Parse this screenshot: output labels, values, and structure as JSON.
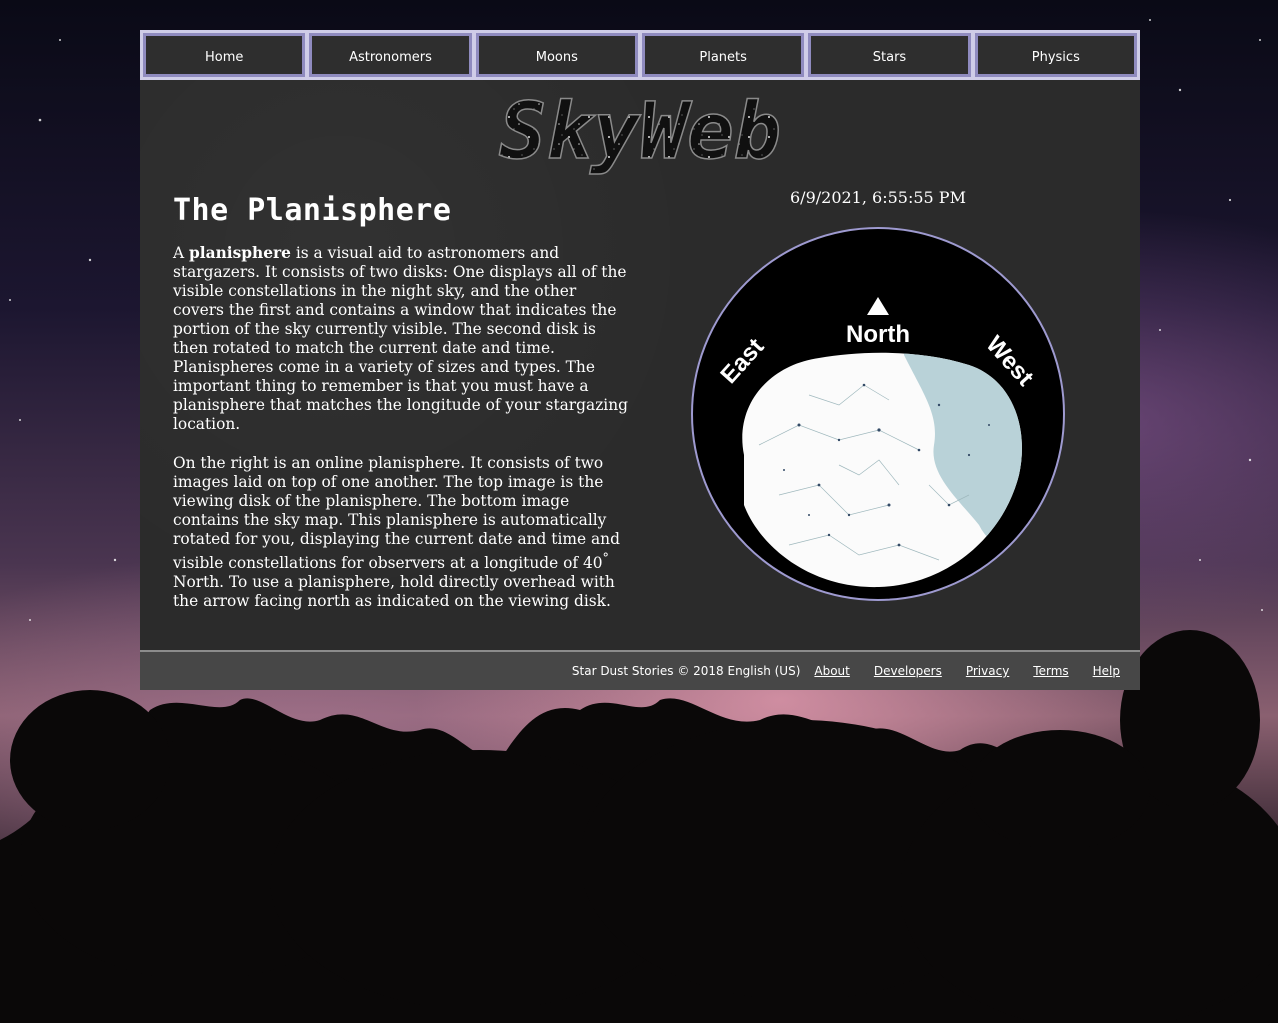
{
  "nav": {
    "items": [
      "Home",
      "Astronomers",
      "Moons",
      "Planets",
      "Stars",
      "Physics"
    ]
  },
  "logo": {
    "text": "SkyWeb"
  },
  "article": {
    "title": "The Planisphere",
    "p1_a": "A ",
    "p1_bold": "planisphere",
    "p1_b": " is a visual aid to astronomers and stargazers. It consists of two disks: One displays all of the visible constellations in the night sky, and the other covers the first and contains a window that indicates the portion of the sky currently visible. The second disk is then rotated to match the current date and time. Planispheres come in a variety of sizes and types. The important thing to remember is that you must have a planisphere that matches the longitude of your stargazing location.",
    "p2_a": "On the right is an online planisphere. It consists of two images laid on top of one another. The top image is the viewing disk of the planisphere. The bottom image contains the sky map. This planisphere is automatically rotated for you, displaying the current date and time and visible constellations for observers at a longitude of 40",
    "p2_deg": "°",
    "p2_b": " North. To use a planisphere, hold directly overhead with the arrow facing north as indicated on the viewing disk."
  },
  "planisphere": {
    "datetime": "6/9/2021, 6:55:55 PM",
    "north_label": "North",
    "east_label": "East",
    "west_label": "West"
  },
  "footer": {
    "copyright": "Star Dust Stories © 2018 English (US)",
    "links": [
      "About",
      "Developers",
      "Privacy",
      "Terms",
      "Help"
    ]
  },
  "colors": {
    "nav_border": "#8f8bbf",
    "nav_frame": "#cfcde8",
    "panel_bg": "#2b2b2b",
    "footer_bg": "#474747"
  }
}
